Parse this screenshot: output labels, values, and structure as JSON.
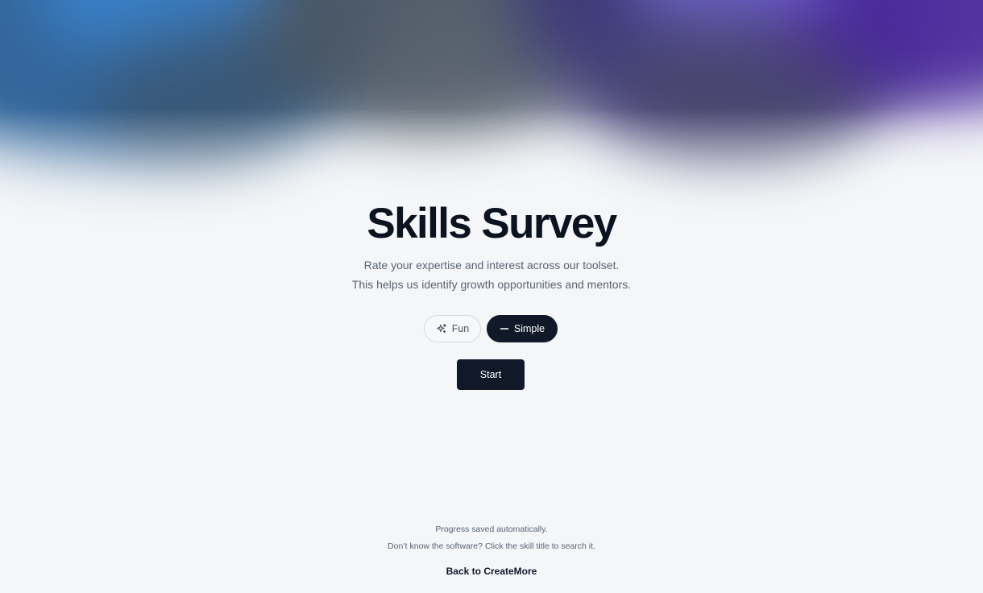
{
  "hero": {
    "title": "Skills Survey",
    "subtitle_line1": "Rate your expertise and interest across our toolset.",
    "subtitle_line2": "This helps us identify growth opportunities and mentors."
  },
  "mode_toggle": {
    "options": [
      {
        "label": "Fun",
        "icon": "sparkles-icon",
        "selected": false
      },
      {
        "label": "Simple",
        "icon": "minus-icon",
        "selected": true
      }
    ]
  },
  "actions": {
    "start_label": "Start"
  },
  "footer": {
    "note_autosave": "Progress saved automatically.",
    "note_search_hint": "Don’t know the software? Click the skill title to search it.",
    "back_link": "Back to CreateMore"
  },
  "colors": {
    "background": "#f4f6f8",
    "primary_dark": "#111827",
    "muted_text": "#5b6472",
    "gradient_blue": "#2a5f97",
    "gradient_purple": "#4a2a9c"
  }
}
